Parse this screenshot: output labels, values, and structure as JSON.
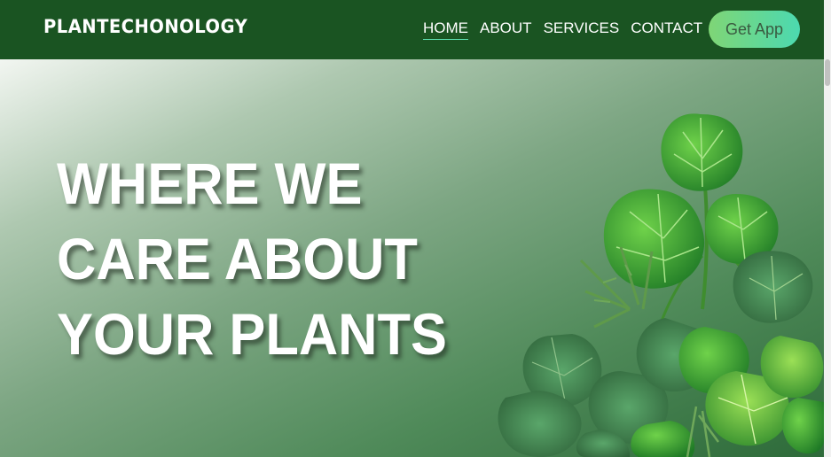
{
  "brand": {
    "logo_text": "PLANTECHONOLOGY"
  },
  "nav": {
    "items": [
      {
        "label": "HOME",
        "active": true
      },
      {
        "label": "ABOUT",
        "active": false
      },
      {
        "label": "SERVICES",
        "active": false
      },
      {
        "label": "CONTACT",
        "active": false
      }
    ],
    "cta_label": "Get App"
  },
  "hero": {
    "headline_lines": [
      "WHERE WE",
      "CARE ABOUT",
      "YOUR PLANTS"
    ],
    "image_icon": "monstera-plants-illustration"
  },
  "colors": {
    "nav_bg": "#1a5422",
    "accent_gradient_start": "#7fd676",
    "accent_gradient_end": "#4cd9b0",
    "active_underline": "#5ee0b0",
    "headline_text": "#ffffff"
  }
}
